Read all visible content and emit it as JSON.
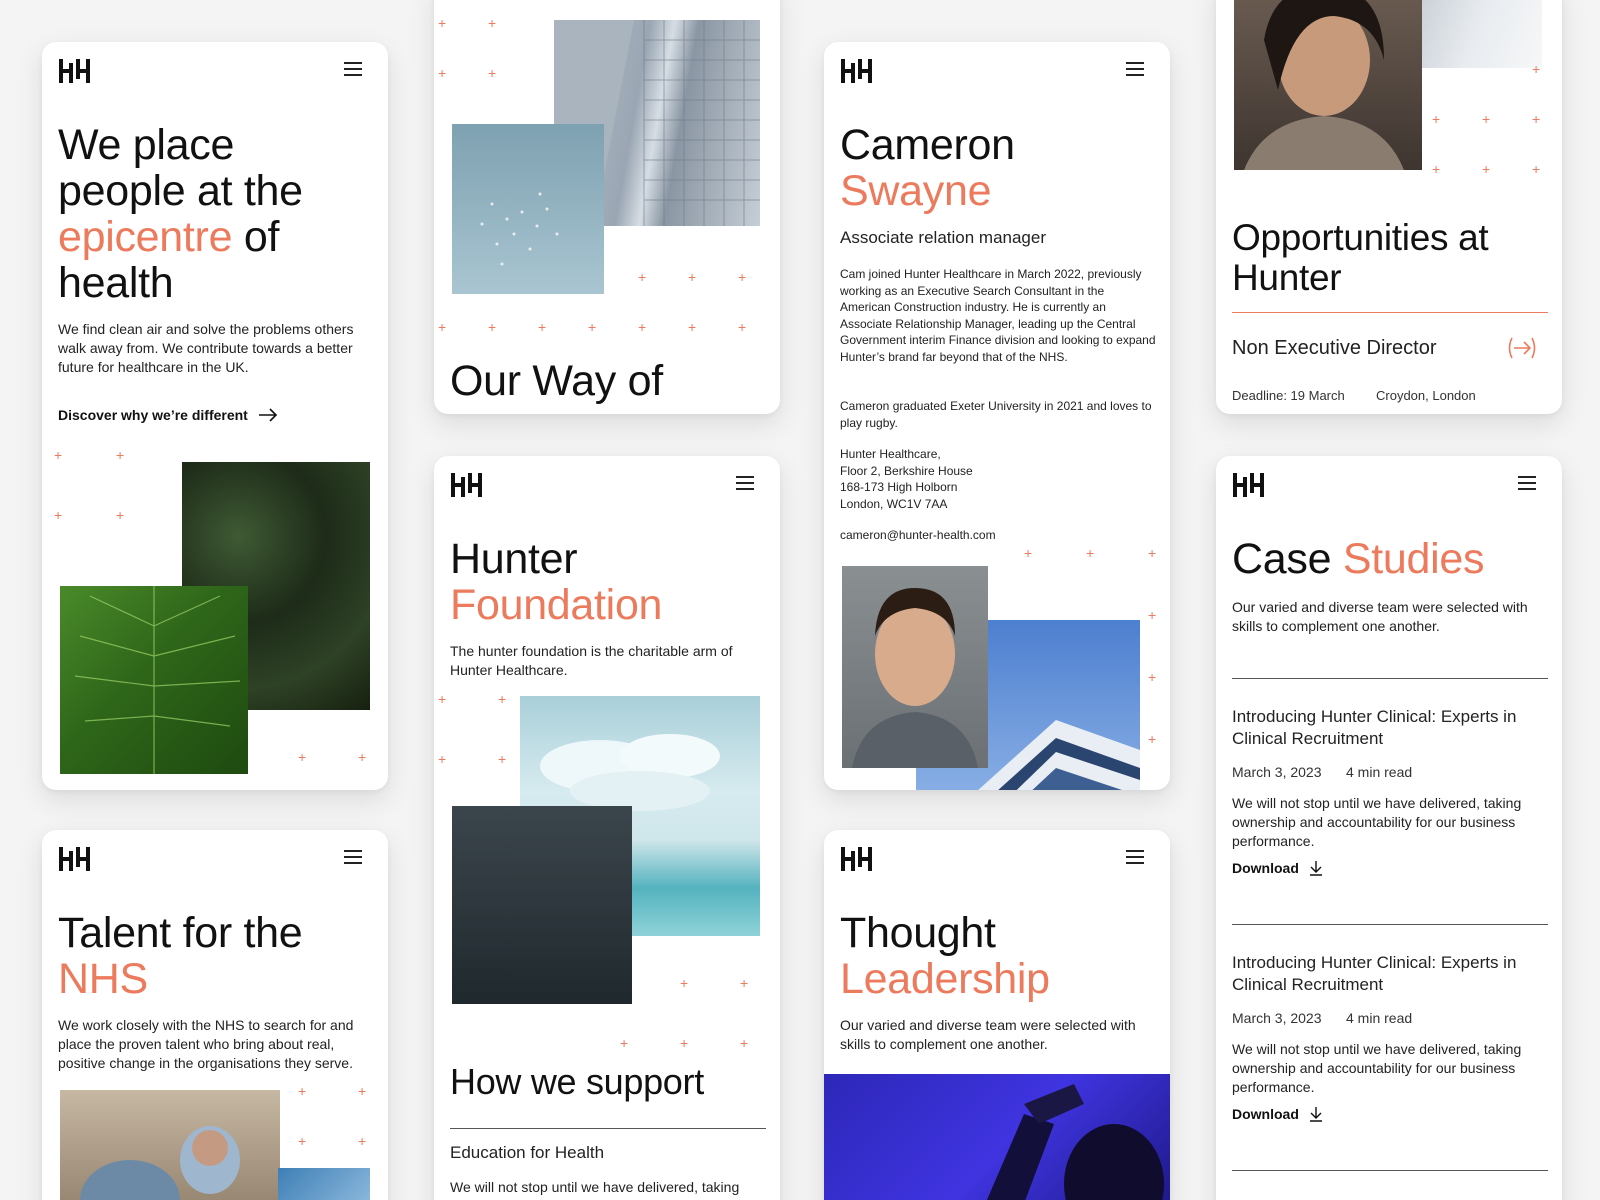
{
  "colors": {
    "accent": "#ec7a5c",
    "text": "#111111"
  },
  "icons": {
    "menu": "hamburger-menu-icon",
    "arrow": "arrow-right-icon",
    "download": "download-icon",
    "circle_arrow": "circle-arrow-right-icon"
  },
  "home": {
    "title_l1": "We place",
    "title_l2": "people at the",
    "title_accent": "epicentre",
    "title_of": " of",
    "title_l4": "health",
    "body": "We find clean air and solve the problems others walk away from. We contribute towards a better future for healthcare in the UK.",
    "cta": "Discover why we’re different"
  },
  "way": {
    "title": "Our Way of"
  },
  "profile": {
    "first": "Cameron",
    "last": "Swayne",
    "role": "Associate relation manager",
    "bio1": "Cam joined Hunter Healthcare in March 2022, previously working as an Executive Search Consultant in the American Construction industry. He is currently an Associate Relationship Manager, leading up the Central Government interim Finance division and looking to expand Hunter’s brand far beyond that of the NHS.",
    "bio2": "Cameron graduated Exeter University in 2021 and loves to play rugby.",
    "addr1": "Hunter Healthcare,",
    "addr2": "Floor 2, Berkshire House",
    "addr3": "168-173 High Holborn",
    "addr4": "London, WC1V 7AA",
    "email": "cameron@hunter-health.com"
  },
  "opps": {
    "title_l1": "Opportunities at",
    "title_l2": "Hunter",
    "job": "Non Executive Director",
    "deadline": "Deadline: 19 March",
    "location": "Croydon, London"
  },
  "foundation": {
    "title_l1": "Hunter",
    "title_l2": "Foundation",
    "body": "The hunter foundation is the charitable arm of Hunter Healthcare.",
    "support_title": "How we support",
    "item": "Education for Health",
    "item_body": "We will not stop until we have delivered, taking ownership and accountability for our business"
  },
  "talent": {
    "title_l1": "Talent for the",
    "title_l2": "NHS",
    "body": "We work closely with the NHS to search for and place the proven talent who bring about real, positive change in the organisations they serve."
  },
  "thought": {
    "title_l1": "Thought",
    "title_l2": "Leadership",
    "body": "Our varied and diverse team were selected with skills to complement one another."
  },
  "cases": {
    "title": "Case",
    "title_accent": "Studies",
    "body": "Our varied and diverse team were selected with skills to complement one another.",
    "items": [
      {
        "title": "Introducing Hunter Clinical: Experts in Clinical Recruitment",
        "date": "March 3, 2023",
        "read": "4 min read",
        "body": "We will not stop until we have delivered, taking ownership and accountability for our business performance.",
        "download": "Download"
      },
      {
        "title": "Introducing Hunter Clinical: Experts in Clinical Recruitment",
        "date": "March 3, 2023",
        "read": "4 min read",
        "body": "We will not stop until we have delivered, taking ownership and accountability for our business performance.",
        "download": "Download"
      }
    ]
  }
}
